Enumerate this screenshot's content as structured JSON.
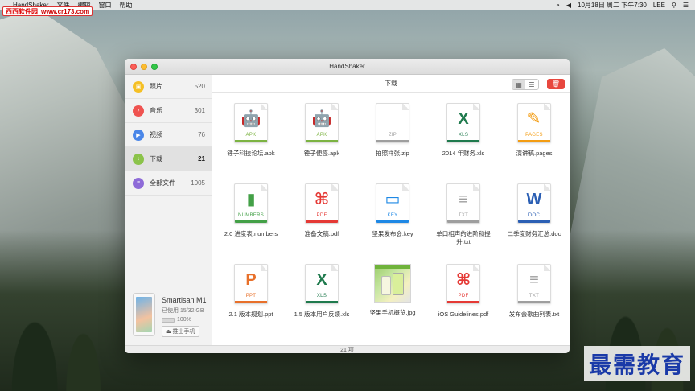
{
  "watermark_top": {
    "brand": "西西软件园",
    "url": "www.cr173.com"
  },
  "watermark_bottom": "最需教育",
  "menubar": {
    "items": [
      "HandShaker",
      "文件",
      "编辑",
      "窗口",
      "帮助"
    ],
    "right": {
      "datetime": "10月18日 周二 下午7:30",
      "user": "LEE"
    }
  },
  "window": {
    "title": "HandShaker",
    "toolbar_title": "下载",
    "status": "21 项"
  },
  "sidebar": {
    "items": [
      {
        "label": "照片",
        "count": "520",
        "icon": "photo-icon",
        "color": "#f5c025"
      },
      {
        "label": "音乐",
        "count": "301",
        "icon": "music-icon",
        "color": "#ef5350"
      },
      {
        "label": "视频",
        "count": "76",
        "icon": "video-icon",
        "color": "#4a86e8"
      },
      {
        "label": "下载",
        "count": "21",
        "icon": "download-icon",
        "color": "#8bc34a"
      },
      {
        "label": "全部文件",
        "count": "1005",
        "icon": "files-icon",
        "color": "#8e6bd8"
      }
    ]
  },
  "device": {
    "name": "Smartisan M1",
    "storage": "已使用 15/32 GB",
    "battery": "100%",
    "eject_label": "推出手机"
  },
  "files": [
    {
      "name": "锤子科技论坛.apk",
      "ext": "APK",
      "glyph": "🤖",
      "color": "#7cb342"
    },
    {
      "name": "锤子便签.apk",
      "ext": "APK",
      "glyph": "🤖",
      "color": "#7cb342"
    },
    {
      "name": "拍照样张.zip",
      "ext": "ZIP",
      "glyph": "",
      "color": "#9e9e9e"
    },
    {
      "name": "2014 年财务.xls",
      "ext": "XLS",
      "glyph": "X",
      "color": "#1f7a4d"
    },
    {
      "name": "演讲稿.pages",
      "ext": "PAGES",
      "glyph": "✎",
      "color": "#f39c12"
    },
    {
      "name": "2.0 进度表.numbers",
      "ext": "NUMBERS",
      "glyph": "▮",
      "color": "#43a047"
    },
    {
      "name": "准备文稿.pdf",
      "ext": "PDF",
      "glyph": "⌘",
      "color": "#e53935"
    },
    {
      "name": "坚果发布会.key",
      "ext": "KEY",
      "glyph": "▭",
      "color": "#1e88e5"
    },
    {
      "name": "单口相声的进阶和提升.txt",
      "ext": "TXT",
      "glyph": "≡",
      "color": "#9e9e9e"
    },
    {
      "name": "二季度财务汇总.doc",
      "ext": "DOC",
      "glyph": "W",
      "color": "#2b5fb4"
    },
    {
      "name": "2.1 版本规划.ppt",
      "ext": "PPT",
      "glyph": "P",
      "color": "#e8702a"
    },
    {
      "name": "1.5 版本用户反馈.xls",
      "ext": "XLS",
      "glyph": "X",
      "color": "#1f7a4d"
    },
    {
      "name": "坚果手机概览.jpg",
      "ext": "",
      "glyph": "",
      "color": "#6fb33b",
      "thumb": true
    },
    {
      "name": "iOS Guidelines.pdf",
      "ext": "PDF",
      "glyph": "⌘",
      "color": "#e53935"
    },
    {
      "name": "发布会歌曲列表.txt",
      "ext": "TXT",
      "glyph": "≡",
      "color": "#9e9e9e"
    }
  ]
}
